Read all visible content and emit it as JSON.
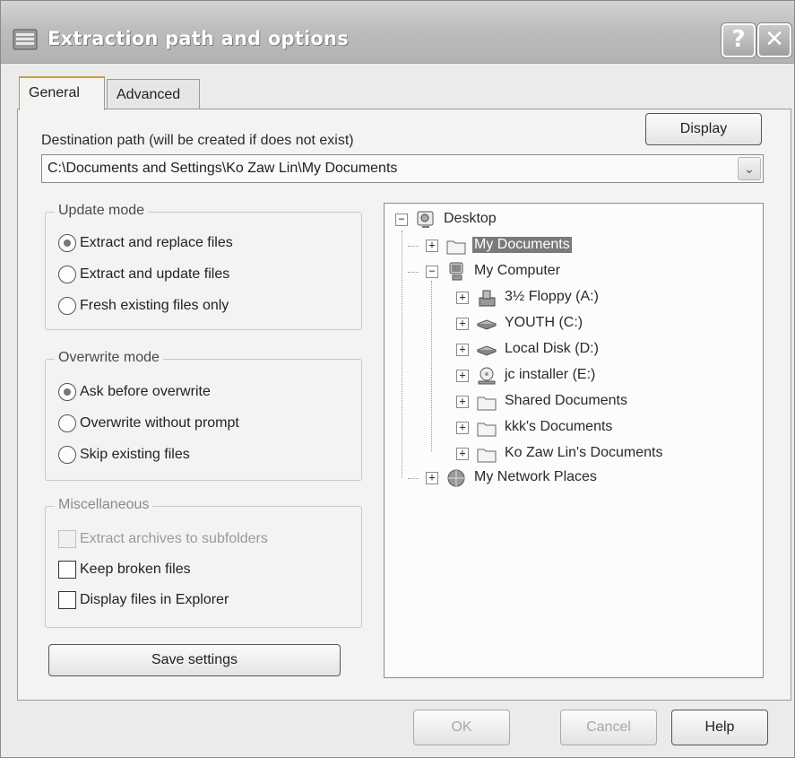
{
  "window": {
    "title": "Extraction path and options",
    "help_glyph": "?",
    "close_glyph": "✕"
  },
  "tabs": [
    {
      "label": "General",
      "active": true
    },
    {
      "label": "Advanced",
      "active": false
    }
  ],
  "destination": {
    "label": "Destination path (will be created if does not exist)",
    "display_button": "Display",
    "path_value": "C:\\Documents and Settings\\Ko Zaw Lin\\My Documents",
    "dropdown_glyph": "⌄"
  },
  "update_mode": {
    "title": "Update mode",
    "options": [
      {
        "label": "Extract and replace files",
        "selected": true
      },
      {
        "label": "Extract and update files",
        "selected": false
      },
      {
        "label": "Fresh existing files only",
        "selected": false
      }
    ]
  },
  "overwrite_mode": {
    "title": "Overwrite mode",
    "options": [
      {
        "label": "Ask before overwrite",
        "selected": true
      },
      {
        "label": "Overwrite without prompt",
        "selected": false
      },
      {
        "label": "Skip existing files",
        "selected": false
      }
    ]
  },
  "misc": {
    "title": "Miscellaneous",
    "options": [
      {
        "label": "Extract archives to subfolders",
        "checked": false,
        "disabled": true
      },
      {
        "label": "Keep broken files",
        "checked": false,
        "disabled": false
      },
      {
        "label": "Display files in Explorer",
        "checked": false,
        "disabled": false
      }
    ]
  },
  "save_button": "Save settings",
  "tree": {
    "items": [
      {
        "label": "Desktop",
        "icon": "desktop-icon",
        "expander": "−"
      },
      {
        "label": "My Documents",
        "icon": "folder-icon",
        "expander": "+",
        "selected": true
      },
      {
        "label": "My Computer",
        "icon": "computer-icon",
        "expander": "−"
      },
      {
        "label": "3½ Floppy (A:)",
        "icon": "floppy-icon",
        "expander": "+"
      },
      {
        "label": "YOUTH (C:)",
        "icon": "drive-icon",
        "expander": "+"
      },
      {
        "label": "Local Disk (D:)",
        "icon": "drive-icon",
        "expander": "+"
      },
      {
        "label": "jc installer (E:)",
        "icon": "cd-drive-icon",
        "expander": "+"
      },
      {
        "label": "Shared Documents",
        "icon": "folder-icon",
        "expander": "+"
      },
      {
        "label": "kkk's Documents",
        "icon": "folder-icon",
        "expander": "+"
      },
      {
        "label": "Ko Zaw Lin's Documents",
        "icon": "folder-icon",
        "expander": "+"
      },
      {
        "label": "My Network Places",
        "icon": "network-icon",
        "expander": "+"
      }
    ]
  },
  "buttons": {
    "ok": "OK",
    "cancel": "Cancel",
    "help": "Help"
  }
}
